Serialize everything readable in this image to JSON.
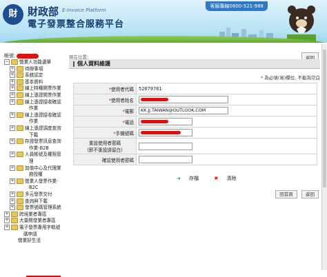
{
  "header": {
    "org_name": "財政部",
    "org_name_en": "E-Invoice Platform",
    "platform_title": "電子發票整合服務平台",
    "hotline": "客服專線0800-521-988",
    "logo_glyph": "財"
  },
  "sidebar": {
    "account_label": "帳號:",
    "items": [
      {
        "label": "營業人功能選單",
        "pm": "−",
        "level": 0
      },
      {
        "label": "待辦事項",
        "pm": "+",
        "level": 1
      },
      {
        "label": "系統認定",
        "pm": "+",
        "level": 1
      },
      {
        "label": "基本資料",
        "pm": "+",
        "level": 1
      },
      {
        "label": "線上特種開票作業",
        "pm": "+",
        "level": 1
      },
      {
        "label": "線上憑證開票作業",
        "pm": "+",
        "level": 1
      },
      {
        "label": "線上憑證接收確認",
        "pm": "+",
        "level": 1
      },
      {
        "label": "作業",
        "pm": "",
        "level": 2
      },
      {
        "label": "線上憑證接收確認",
        "pm": "+",
        "level": 1
      },
      {
        "label": "作業",
        "pm": "",
        "level": 2
      },
      {
        "label": "線上憑證調度查詢",
        "pm": "+",
        "level": 1
      },
      {
        "label": "下載",
        "pm": "",
        "level": 2
      },
      {
        "label": "存證發票訊息查詢",
        "pm": "+",
        "level": 1
      },
      {
        "label": "作業-B2B",
        "pm": "",
        "level": 2
      },
      {
        "label": "人員帳號及權限管",
        "pm": "+",
        "level": 1
      },
      {
        "label": "理",
        "pm": "",
        "level": 2
      },
      {
        "label": "加值中心及代理業",
        "pm": "+",
        "level": 1
      },
      {
        "label": "務授權",
        "pm": "",
        "level": 2
      },
      {
        "label": "營業人發票作業-",
        "pm": "+",
        "level": 1
      },
      {
        "label": "B2C",
        "pm": "",
        "level": 2
      },
      {
        "label": "多元發票交付",
        "pm": "+",
        "level": 1
      },
      {
        "label": "查詢與下載",
        "pm": "+",
        "level": 1
      },
      {
        "label": "發票號碼管理系統",
        "pm": "+",
        "level": 1
      },
      {
        "label": "跨境業者專區",
        "pm": "+",
        "level": 0
      },
      {
        "label": "大量開發業者專區",
        "pm": "+",
        "level": 0
      },
      {
        "label": "電子發票專用字軌號",
        "pm": "+",
        "level": 0
      },
      {
        "label": "碼申請",
        "pm": "",
        "level": 1
      },
      {
        "label": "營業好生活",
        "pm": "",
        "level": 0
      }
    ]
  },
  "main": {
    "breadcrumb": "現在位置：",
    "back_top": "返回",
    "page_title": "個人資料維護",
    "required_note": "為必填(寫)欄位, 不能為空白",
    "required_mark": "*",
    "fields": [
      {
        "label": "使用者代碼",
        "required": true,
        "value": "52679781"
      },
      {
        "label": "使用者姓名",
        "required": true,
        "value": ""
      },
      {
        "label": "電郵",
        "required": true,
        "value": "KK.JJ.TAIWAN@OUTLOOK.COM"
      },
      {
        "label": "電話",
        "required": true,
        "value": ""
      },
      {
        "label": "手機號碼",
        "required": true,
        "value": ""
      },
      {
        "label": "重設使用者密碼\n（即不重設請留白）",
        "required": false,
        "value": ""
      },
      {
        "label": "確認使用者密碼",
        "required": false,
        "value": ""
      }
    ],
    "save_label": "存檔",
    "clear_label": "清除",
    "back_page": "回首頁",
    "back_bottom": "返回"
  },
  "colors": {
    "accent": "#163c72",
    "redact": "#e01010",
    "header_bg": "#b9e4f5"
  }
}
